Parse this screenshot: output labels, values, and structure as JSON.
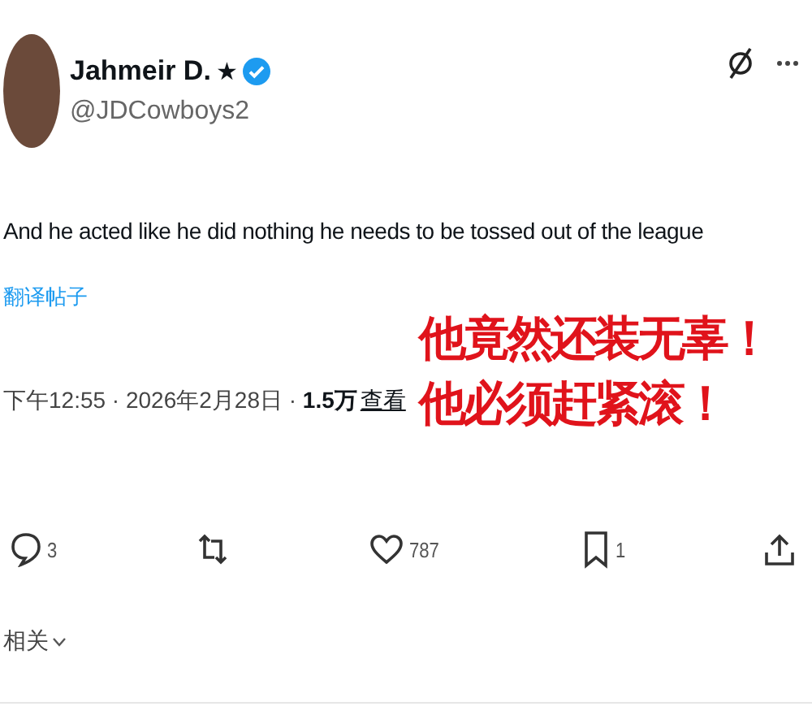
{
  "author": {
    "name": "Jahmeir D.",
    "badge": "★",
    "verified": true,
    "handle": "@JDCowboys2"
  },
  "tweet": {
    "text": "And he acted like he did nothing he needs to be tossed out of the league",
    "translate_link": "翻译帖子",
    "meta": "下午12:55 · 2026年2月28日 · **1.5万**",
    "views_link": "查看"
  },
  "actions": [
    {
      "kind": "reply",
      "count": "3"
    },
    {
      "kind": "repost"
    },
    {
      "kind": "like",
      "count": "787"
    },
    {
      "kind": "bookmark",
      "count": "1"
    },
    {
      "kind": "share"
    }
  ],
  "related": {
    "label": "相关"
  },
  "overlay_caption": [
    "他竟然还装无辜！",
    "他必须赶紧滚！"
  ]
}
